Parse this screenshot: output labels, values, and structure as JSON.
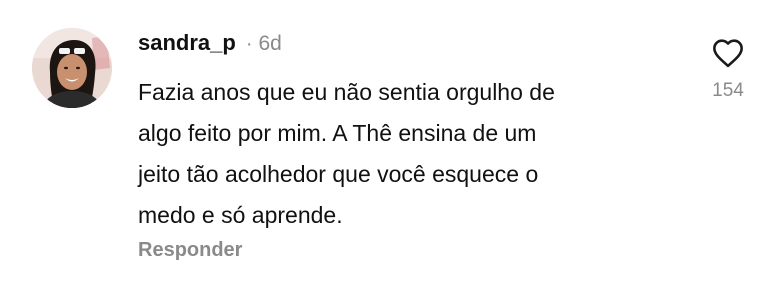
{
  "comment": {
    "username": "sandra_p",
    "separator": "·",
    "time": "6d",
    "lines": [
      "Fazia anos que eu não sentia orgulho de",
      "algo feito por mim. A Thê ensina de um",
      "jeito tão acolhedor que você esquece o",
      "medo e só aprende."
    ],
    "reply_label": "Responder",
    "like_count": "154",
    "icons": {
      "avatar": "avatar",
      "like": "heart-outline-icon"
    }
  }
}
